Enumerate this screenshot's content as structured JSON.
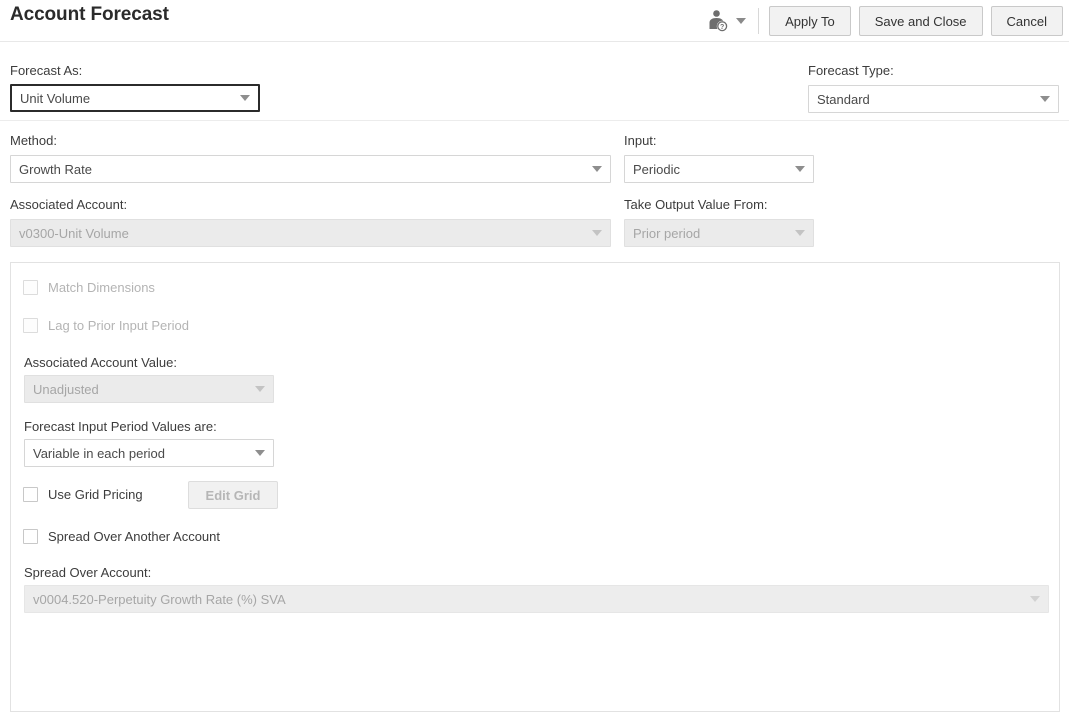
{
  "header": {
    "title": "Account Forecast",
    "user_help_icon": "user-help-icon",
    "chevron_icon": "chevron-down-icon",
    "buttons": [
      {
        "label": "Apply To",
        "name": "apply-to-button"
      },
      {
        "label": "Save and Close",
        "name": "save-and-close-button"
      },
      {
        "label": "Cancel",
        "name": "cancel-button"
      }
    ]
  },
  "form": {
    "forecast_as": {
      "label": "Forecast As:",
      "value": "Unit Volume"
    },
    "forecast_type": {
      "label": "Forecast Type:",
      "value": "Standard"
    },
    "method": {
      "label": "Method:",
      "value": "Growth Rate"
    },
    "input": {
      "label": "Input:",
      "value": "Periodic"
    },
    "associated_account": {
      "label": "Associated Account:",
      "value": "v0300-Unit Volume"
    },
    "take_output_value_from": {
      "label": "Take Output Value From:",
      "value": "Prior period"
    }
  },
  "panel": {
    "match_dimensions": {
      "label": "Match Dimensions",
      "checked": false
    },
    "lag_to_prior_input_period": {
      "label": "Lag to Prior Input Period",
      "checked": false
    },
    "associated_account_value": {
      "label": "Associated Account Value:",
      "value": "Unadjusted"
    },
    "forecast_input_period_values": {
      "label": "Forecast Input Period Values are:",
      "value": "Variable in each period"
    },
    "use_grid_pricing": {
      "label": "Use Grid Pricing",
      "checked": false
    },
    "edit_grid_button": {
      "label": "Edit Grid"
    },
    "spread_over_another_account": {
      "label": "Spread Over Another Account",
      "checked": false
    },
    "spread_over_account": {
      "label": "Spread Over Account:",
      "value": "v0004.520-Perpetuity Growth Rate (%) SVA"
    }
  },
  "colors": {
    "text": "#333333",
    "muted": "#b0b0b0",
    "border": "#d6d6d6",
    "disabled_bg": "#ebebeb",
    "button_bg": "#f2f2f2"
  }
}
